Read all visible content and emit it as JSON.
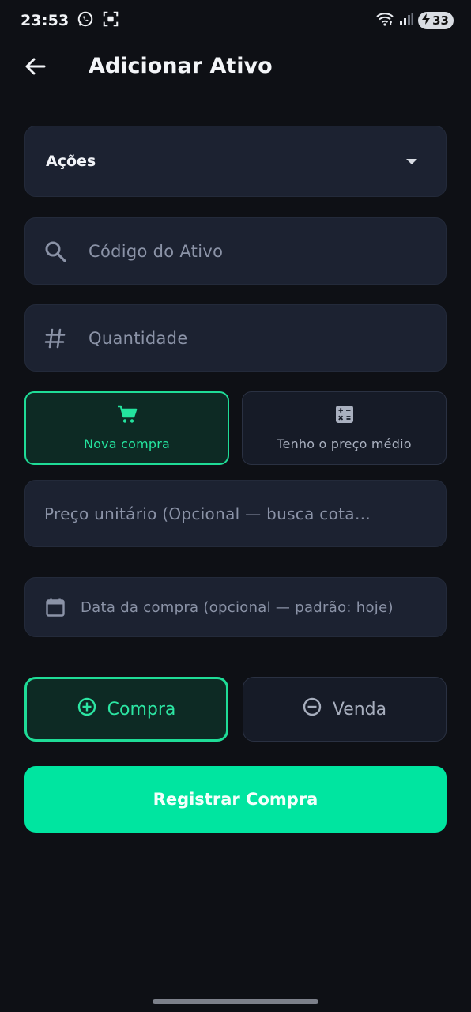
{
  "status_bar": {
    "time": "23:53",
    "battery": "33",
    "icons": [
      "whatsapp-icon",
      "screen-record-icon",
      "wifi-icon",
      "signal-icon",
      "battery-charging-icon"
    ]
  },
  "header": {
    "title": "Adicionar Ativo",
    "back_icon": "arrow-left-icon"
  },
  "form": {
    "asset_type": {
      "value": "Ações",
      "icon": "caret-down-icon"
    },
    "ticker": {
      "placeholder": "Código do Ativo",
      "value": "",
      "icon": "search-icon"
    },
    "quantity": {
      "placeholder": "Quantidade",
      "value": "",
      "icon": "hash-icon"
    },
    "modes": [
      {
        "label": "Nova compra",
        "icon": "cart-icon",
        "selected": true
      },
      {
        "label": "Tenho o preço médio",
        "icon": "calculator-icon",
        "selected": false
      }
    ],
    "unit_price": {
      "placeholder": "Preço unitário (Opcional — busca cota…",
      "value": ""
    },
    "purchase_date": {
      "placeholder": "Data da compra (opcional — padrão: hoje)",
      "value": "",
      "icon": "calendar-icon"
    },
    "operations": [
      {
        "label": "Compra",
        "icon": "plus-circle-icon",
        "selected": true
      },
      {
        "label": "Venda",
        "icon": "minus-circle-icon",
        "selected": false
      }
    ],
    "submit_label": "Registrar Compra"
  },
  "colors": {
    "background": "#0e1015",
    "card": "#1c2231",
    "accent": "#00e5a0",
    "accent_border": "#1fdc97",
    "muted_text": "#8b93a7"
  }
}
